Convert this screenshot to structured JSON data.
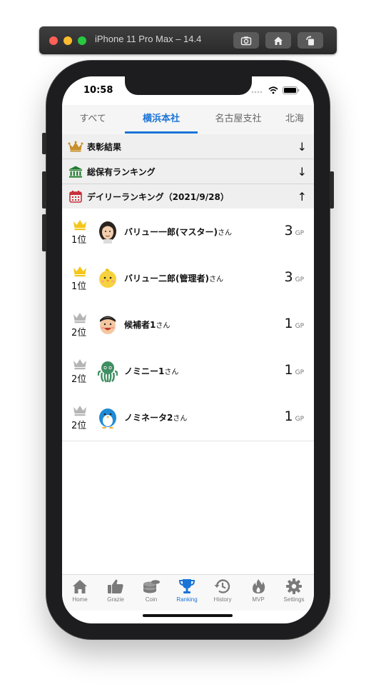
{
  "simulator": {
    "title": "iPhone 11 Pro Max – 14.4"
  },
  "status_bar": {
    "time": "10:58"
  },
  "tabs": [
    {
      "label": "すべて"
    },
    {
      "label": "横浜本社"
    },
    {
      "label": "名古屋支社"
    },
    {
      "label": "北海"
    }
  ],
  "active_tab": "横浜本社",
  "sections": [
    {
      "label": "表彰結果",
      "icon": "crown-icon",
      "arrow": "↓",
      "color": "#c8902a"
    },
    {
      "label": "総保有ランキング",
      "icon": "bank-icon",
      "arrow": "↓",
      "color": "#1f7a2e"
    },
    {
      "label": "デイリーランキング（2021/9/28）",
      "icon": "calendar-icon",
      "arrow": "↑",
      "color": "#c8313a"
    }
  ],
  "ranking": [
    {
      "rank": "1位",
      "name": "バリュー一郎(マスター)",
      "suffix": "さん",
      "points": "3",
      "unit": "GP",
      "crown": "gold",
      "avatar": "man-with-long-hair"
    },
    {
      "rank": "1位",
      "name": "バリュー二郎(管理者)",
      "suffix": "さん",
      "points": "3",
      "unit": "GP",
      "crown": "gold",
      "avatar": "chick"
    },
    {
      "rank": "2位",
      "name": "候補者1",
      "suffix": "さん",
      "points": "1",
      "unit": "GP",
      "crown": "silver",
      "avatar": "smiling-boy"
    },
    {
      "rank": "2位",
      "name": "ノミニー1",
      "suffix": "さん",
      "points": "1",
      "unit": "GP",
      "crown": "silver",
      "avatar": "green-octopus-monster"
    },
    {
      "rank": "2位",
      "name": "ノミネータ2",
      "suffix": "さん",
      "points": "1",
      "unit": "GP",
      "crown": "silver",
      "avatar": "blue-penguin"
    }
  ],
  "tabbar": [
    {
      "label": "Home",
      "icon": "home-icon"
    },
    {
      "label": "Grazie",
      "icon": "thumbs-up-icon"
    },
    {
      "label": "Coin",
      "icon": "coins-icon"
    },
    {
      "label": "Ranking",
      "icon": "trophy-icon"
    },
    {
      "label": "History",
      "icon": "history-icon"
    },
    {
      "label": "MVP",
      "icon": "flame-icon"
    },
    {
      "label": "Settings",
      "icon": "gear-icon"
    }
  ],
  "active_tabbar": "Ranking",
  "colors": {
    "accent": "#1a74d8",
    "gold": "#f5c518",
    "silver": "#b5b5b5"
  }
}
